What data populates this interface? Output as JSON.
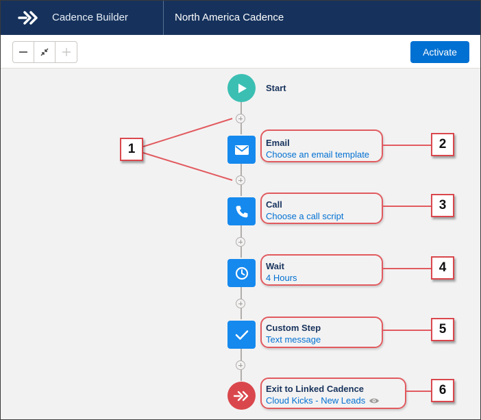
{
  "header": {
    "app_name": "Cadence Builder",
    "cadence_name": "North America Cadence"
  },
  "toolbar": {
    "zoom_out": "zoom-out",
    "fit": "fit-to-screen",
    "zoom_in": "zoom-in",
    "activate_label": "Activate"
  },
  "steps": [
    {
      "title": "Start",
      "icon": "play-icon",
      "color": "#3bbfb3"
    },
    {
      "title": "Email",
      "link": "Choose an email template",
      "icon": "email-icon",
      "color": "#1589ee"
    },
    {
      "title": "Call",
      "link": "Choose a call script",
      "icon": "phone-icon",
      "color": "#1589ee"
    },
    {
      "title": "Wait",
      "link": "4 Hours",
      "icon": "clock-icon",
      "color": "#1589ee"
    },
    {
      "title": "Custom Step",
      "link": "Text message",
      "icon": "check-icon",
      "color": "#1589ee"
    },
    {
      "title": "Exit to Linked Cadence",
      "link": "Cloud Kicks - New Leads",
      "icon": "exit-arrow-icon",
      "color": "#d9474c"
    }
  ],
  "callouts": [
    "1",
    "2",
    "3",
    "4",
    "5",
    "6"
  ],
  "colors": {
    "header_bg": "#16325c",
    "accent": "#0070d2",
    "highlight": "#e15a5f"
  }
}
